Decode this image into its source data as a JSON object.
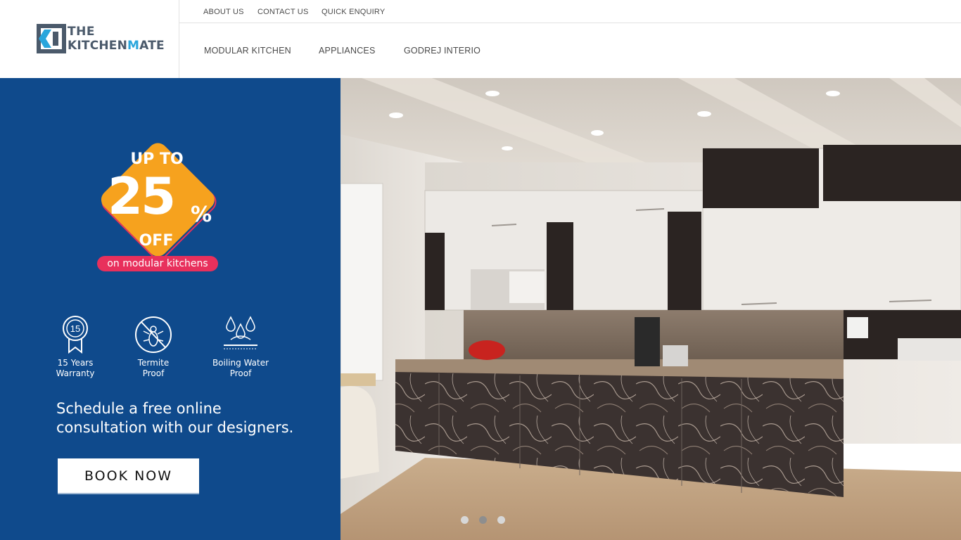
{
  "brand": {
    "line1": "THE",
    "line2_a": "KITCHEN",
    "line2_m": "M",
    "line2_b": "ATE"
  },
  "top_nav": [
    "ABOUT US",
    "CONTACT US",
    "QUICK ENQUIRY"
  ],
  "main_nav": [
    "MODULAR KITCHEN",
    "APPLIANCES",
    "GODREJ INTERIO"
  ],
  "promo": {
    "up_to": "UP TO",
    "percent_number": "25",
    "percent_sign": "%",
    "off": "OFF",
    "tagline": "on modular kitchens",
    "features": [
      {
        "icon": "warranty-15-icon",
        "icon_text": "15",
        "label_1": "15 Years",
        "label_2": "Warranty"
      },
      {
        "icon": "termite-proof-icon",
        "label_1": "Termite",
        "label_2": "Proof"
      },
      {
        "icon": "boiling-water-icon",
        "label_1": "Boiling Water",
        "label_2": "Proof"
      }
    ],
    "schedule_line1": "Schedule a free online",
    "schedule_line2": "consultation with our designers.",
    "cta": "BOOK NOW"
  },
  "carousel": {
    "slides": 3,
    "active_index": 1
  },
  "colors": {
    "promo_bg": "#0f4a8c",
    "badge_orange": "#f6a21e",
    "pill_pink": "#e8305c",
    "logo_blue": "#2aa6dc",
    "logo_gray": "#4b5a6b"
  }
}
